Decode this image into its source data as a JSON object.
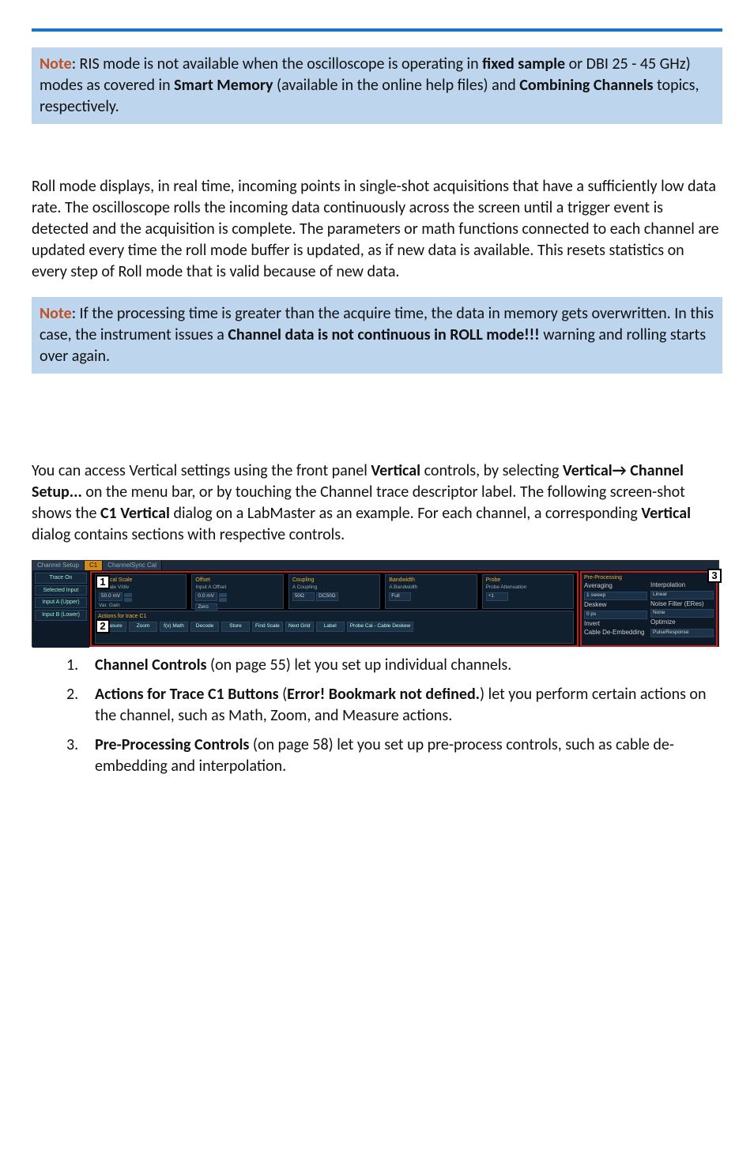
{
  "rule": true,
  "note1": {
    "label": "Note",
    "text_a": ": RIS mode is not available when the oscilloscope is operating in ",
    "bold_a": "fixed sample",
    "text_b": " or DBI 25 - 45 GHz) modes as covered in ",
    "bold_b": "Smart Memory",
    "text_c": " (available in the online help files) and ",
    "bold_c": "Combining Channels",
    "text_d": " topics, respectively."
  },
  "para_roll": "Roll mode displays, in real time, incoming points in single-shot acquisitions that have a sufficiently low data rate. The oscilloscope rolls the incoming data continuously across the screen until a trigger event is detected and the acquisition is complete. The parameters or math functions connected to each channel are updated every time the roll mode buffer is updated, as if new data is available. This resets statistics on every step of Roll mode that is valid because of new data.",
  "note2": {
    "label": "Note",
    "text_a": ": If the processing time is greater than the acquire time, the data in memory gets overwritten. In this case, the instrument issues a ",
    "bold_a": "Channel data is not continuous in ROLL mode!!!",
    "text_b": " warning and rolling starts over again."
  },
  "vert_para": {
    "t1": "You can access Vertical settings using the front panel ",
    "b1": "Vertical",
    "t2": " controls, by selecting ",
    "b2": "Vertical→ Channel Setup...",
    "t3": " on the menu bar, or by touching the Channel trace descriptor label. The following screen-shot shows the ",
    "b3": "C1 Vertical",
    "t4": " dialog on a LabMaster as an example. For each channel, a corresponding ",
    "b4": "Vertical",
    "t5": " dialog contains sections with respective controls."
  },
  "screenshot": {
    "tabs": {
      "t0": "Channel Setup",
      "t1": "C1",
      "t2": "ChannelSync Cal"
    },
    "left": {
      "trace_on": "Trace On",
      "selected": "Selected Input",
      "input_a": "Input A (Upper)",
      "input_b": "Input B (Lower)"
    },
    "groups": {
      "vscale": {
        "title": "Vertical Scale",
        "sub": "A Scale V/div",
        "val": "50.0 mV",
        "var": "Var. Gain"
      },
      "offset": {
        "title": "Offset",
        "sub": "Input A Offset",
        "val": "0.0 mV",
        "zero": "Zero"
      },
      "coupling": {
        "title": "Coupling",
        "sub": "A Coupling",
        "val": "DC50Ω",
        "imp": "50Ω"
      },
      "bandwidth": {
        "title": "Bandwidth",
        "sub": "A Bandwidth",
        "val": "Full"
      },
      "probe": {
        "title": "Probe",
        "sub": "Probe Attenuation",
        "val": "÷1"
      }
    },
    "actions": {
      "title": "Actions for trace C1",
      "btns": {
        "measure": "Measure",
        "zoom": "Zoom",
        "math": "f(x) Math",
        "decode": "Decode",
        "store": "Store",
        "find": "Find Scale",
        "next": "Next Grid",
        "label": "Label",
        "probecal": "Probe Cal - Cable Deskew"
      }
    },
    "right": {
      "pp_title": "Pre-Processing",
      "averaging": "Averaging",
      "avg_val": "1 sweep",
      "deskew": "Deskew",
      "deskew_val": "0 ps",
      "invert": "Invert",
      "cde": "Cable De-Embedding",
      "interp": "Interpolation",
      "interp_val": "Linear",
      "nf": "Noise Filter (ERes)",
      "nf_val": "None",
      "opt": "Optimize",
      "pr": "PulseResponse"
    },
    "marks": {
      "m1": "1",
      "m2": "2",
      "m3": "3"
    }
  },
  "list": {
    "i1": {
      "b": "Channel Controls",
      "t": " (on page 55) let you set up individual channels."
    },
    "i2": {
      "b": "Actions for Trace C1 Buttons",
      "paren_a": " (",
      "b2": "Error! Bookmark not defined.",
      "paren_b": ")",
      "t": " let you perform certain actions on the channel, such as Math, Zoom, and Measure actions."
    },
    "i3": {
      "b": "Pre-Processing Controls",
      "t": " (on page 58) let you set up pre-process controls, such as cable de-embedding and interpolation."
    }
  }
}
